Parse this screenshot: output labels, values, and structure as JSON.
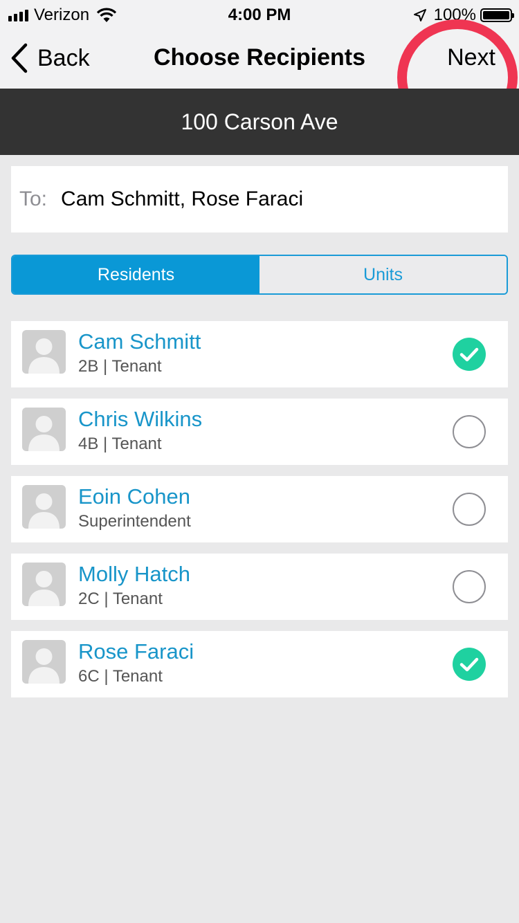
{
  "status_bar": {
    "carrier": "Verizon",
    "time": "4:00 PM",
    "battery": "100%"
  },
  "nav": {
    "back_label": "Back",
    "title": "Choose Recipients",
    "next_label": "Next"
  },
  "address": "100 Carson Ave",
  "to_field": {
    "label": "To:",
    "value": "Cam Schmitt, Rose Faraci"
  },
  "segments": [
    {
      "label": "Residents",
      "active": true
    },
    {
      "label": "Units",
      "active": false
    }
  ],
  "residents": [
    {
      "name": "Cam Schmitt",
      "detail": "2B | Tenant",
      "selected": true
    },
    {
      "name": "Chris Wilkins",
      "detail": "4B | Tenant",
      "selected": false
    },
    {
      "name": "Eoin Cohen",
      "detail": "Superintendent",
      "selected": false
    },
    {
      "name": "Molly Hatch",
      "detail": "2C | Tenant",
      "selected": false
    },
    {
      "name": "Rose Faraci",
      "detail": "6C | Tenant",
      "selected": true
    }
  ],
  "colors": {
    "accent": "#0a98d6",
    "name_text": "#1895c9",
    "check_green": "#1fd1a0",
    "highlight_circle": "#ef3552",
    "address_bar": "#333333"
  }
}
